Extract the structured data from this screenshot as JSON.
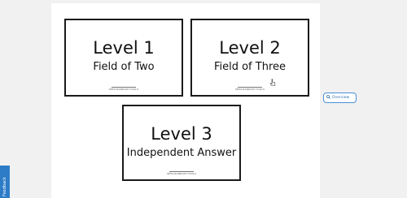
{
  "cards": [
    {
      "title": "Level 1",
      "subtitle": "Field of Two",
      "logo_text": "SEMI-RANDOM TOOLS"
    },
    {
      "title": "Level 2",
      "subtitle": "Field of Three",
      "logo_text": "SEMI-RANDOM TOOLS"
    },
    {
      "title": "Level 3",
      "subtitle": "Independent Answer",
      "logo_text": "SEMI-RANDOM TOOLS"
    }
  ],
  "overview_button": {
    "label": "Overview",
    "icon": "search-icon"
  },
  "feedback_tab": {
    "label": "Feedback"
  },
  "colors": {
    "page_bg": "#f1f1f1",
    "panel_bg": "#ffffff",
    "card_border": "#1a1a1a",
    "accent": "#2c7cc7"
  }
}
